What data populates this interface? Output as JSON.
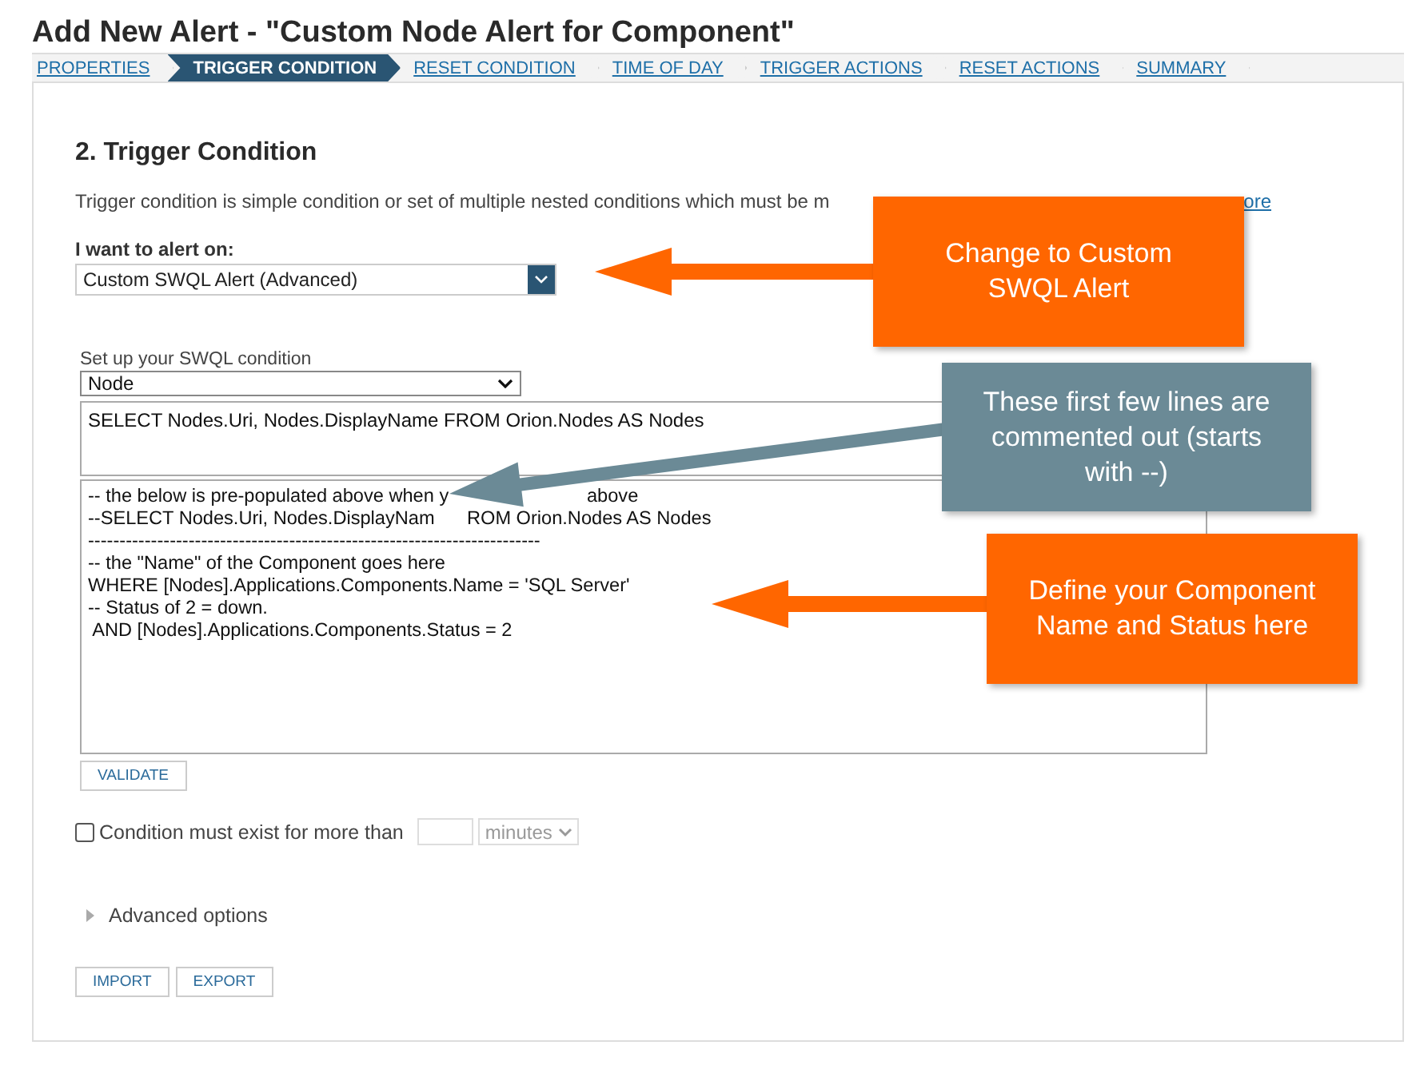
{
  "title": "Add New Alert - \"Custom Node Alert for Component\"",
  "steps": [
    {
      "label": "PROPERTIES",
      "selected": false
    },
    {
      "label": "TRIGGER CONDITION",
      "selected": true
    },
    {
      "label": "RESET CONDITION",
      "selected": false
    },
    {
      "label": "TIME OF DAY",
      "selected": false
    },
    {
      "label": "TRIGGER ACTIONS",
      "selected": false
    },
    {
      "label": "RESET ACTIONS",
      "selected": false
    },
    {
      "label": "SUMMARY",
      "selected": false
    }
  ],
  "section": {
    "heading": "2. Trigger Condition",
    "description": "Trigger condition is simple condition or set of multiple nested conditions which must be m",
    "link": "ore"
  },
  "alert_on": {
    "label": "I want to alert on:",
    "value": "Custom SWQL Alert (Advanced)"
  },
  "swql": {
    "label": "Set up your SWQL condition",
    "object_type": "Node",
    "select_clause": "SELECT Nodes.Uri, Nodes.DisplayName FROM Orion.Nodes AS Nodes",
    "lines": [
      [
        "-- the below is pre-populated above when y",
        "above"
      ],
      [
        "--SELECT Nodes.Uri, Nodes.DisplayNam",
        "ROM Orion.Nodes AS Nodes"
      ],
      [
        "------------------------------------------------------------------------"
      ],
      [
        "-- the \"Name\" of the Component goes here"
      ],
      [
        "WHERE [Nodes].Applications.Components.Name = 'SQL Server'"
      ],
      [
        "-- Status of 2 = down."
      ],
      [
        " AND [Nodes].Applications.Components.Status = 2"
      ]
    ],
    "validate": "VALIDATE"
  },
  "condition": {
    "checked": false,
    "label": "Condition must exist for more than",
    "unit": "minutes"
  },
  "advanced": {
    "label": "Advanced options",
    "expanded": false
  },
  "buttons": [
    "IMPORT",
    "EXPORT"
  ],
  "callouts": [
    {
      "text": "Change to Custom SWQL Alert",
      "color": "#ff6600"
    },
    {
      "text": "These first few lines are commented out (starts with --)",
      "color": "#6b8a96"
    },
    {
      "text": "Define your Component Name and Status here",
      "color": "#ff6600"
    }
  ]
}
